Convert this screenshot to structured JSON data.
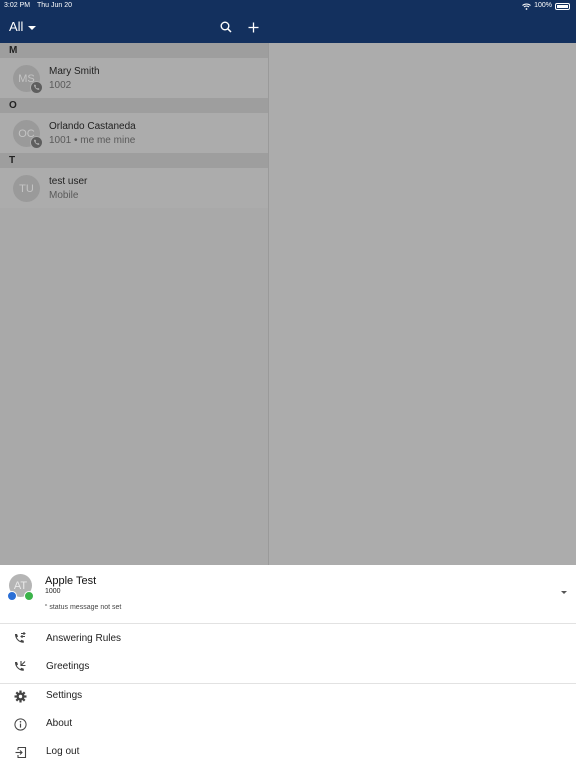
{
  "status_bar": {
    "time": "3:02 PM",
    "date": "Thu Jun 20",
    "battery": "100%"
  },
  "header": {
    "filter_label": "All"
  },
  "contacts": {
    "sections": [
      {
        "letter": "M",
        "items": [
          {
            "initials": "MS",
            "name": "Mary Smith",
            "sub": "1002"
          }
        ]
      },
      {
        "letter": "O",
        "items": [
          {
            "initials": "OC",
            "name": "Orlando Castaneda",
            "sub": "1001 • me me mine"
          }
        ]
      },
      {
        "letter": "T",
        "items": [
          {
            "initials": "TU",
            "name": "test user",
            "sub": "Mobile"
          }
        ]
      }
    ]
  },
  "profile": {
    "initials": "AT",
    "name": "Apple Test",
    "extension": "1000",
    "status_message": "status message not set"
  },
  "menu": {
    "answering_rules": "Answering Rules",
    "greetings": "Greetings",
    "settings": "Settings",
    "about": "About",
    "logout": "Log out"
  },
  "colors": {
    "header": "#13305e",
    "overlay": "#ababab",
    "presence_online": "#3bb34a",
    "presence_chat": "#2a6fd6"
  },
  "icons": [
    "search-icon",
    "plus-icon",
    "phone-icon",
    "answering-rules-icon",
    "greetings-icon",
    "gear-icon",
    "info-icon",
    "logout-icon",
    "wifi-icon",
    "battery-icon"
  ]
}
